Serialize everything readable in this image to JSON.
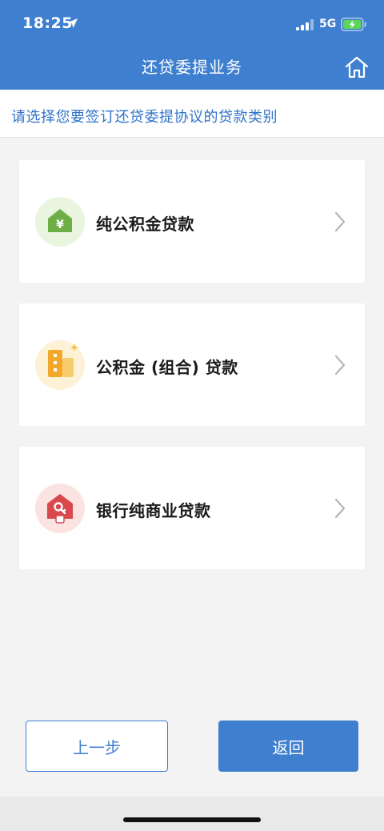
{
  "status_bar": {
    "time": "18:25",
    "network": "5G"
  },
  "nav": {
    "title": "还贷委提业务",
    "home_icon": "home-icon"
  },
  "instruction": "请选择您要签订还贷委提协议的贷款类别",
  "loan_types": [
    {
      "label": "纯公积金贷款",
      "icon": "house-yen-icon",
      "color": "#6fae46"
    },
    {
      "label": "公积金 (组合) 贷款",
      "icon": "building-icon",
      "color": "#f2a82b"
    },
    {
      "label": "银行纯商业贷款",
      "icon": "house-key-icon",
      "color": "#d9484c"
    }
  ],
  "buttons": {
    "prev": "上一步",
    "back": "返回"
  },
  "colors": {
    "primary": "#3f7fcf",
    "background": "#f3f3f4"
  }
}
